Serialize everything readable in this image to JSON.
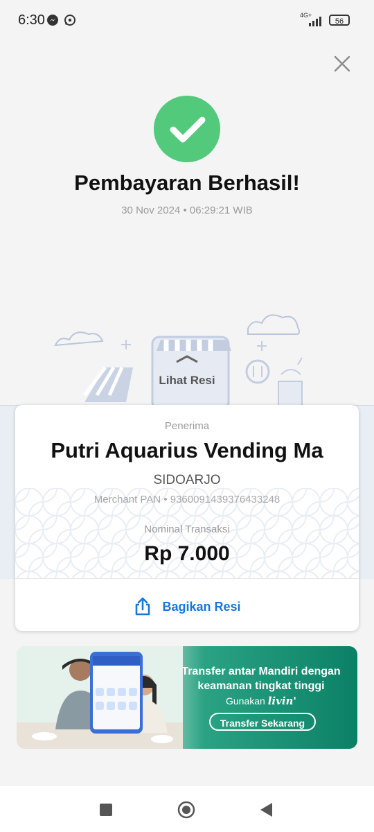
{
  "status_bar": {
    "time": "6:30",
    "network": "4G+",
    "battery": "56",
    "app_icons": [
      "messenger-icon",
      "whatsapp-icon"
    ]
  },
  "result": {
    "title": "Pembayaran Berhasil!",
    "datetime": "30 Nov 2024 • 06:29:21 WIB",
    "view_receipt": "Lihat Resi"
  },
  "receipt": {
    "recipient_label": "Penerima",
    "recipient_name": "Putri Aquarius Vending Ma",
    "city": "SIDOARJO",
    "merchant_pan": "Merchant PAN • 9360091439376433248",
    "amount_label": "Nominal Transaksi",
    "amount": "Rp 7.000",
    "share_label": "Bagikan Resi"
  },
  "banner": {
    "headline": "Transfer antar Mandiri dengan keamanan tingkat tinggi",
    "sub": "Gunakan",
    "brand": "livin'",
    "cta": "Transfer Sekarang"
  },
  "colors": {
    "success": "#53c97b",
    "link": "#1677d9",
    "banner": "#0b8066"
  }
}
